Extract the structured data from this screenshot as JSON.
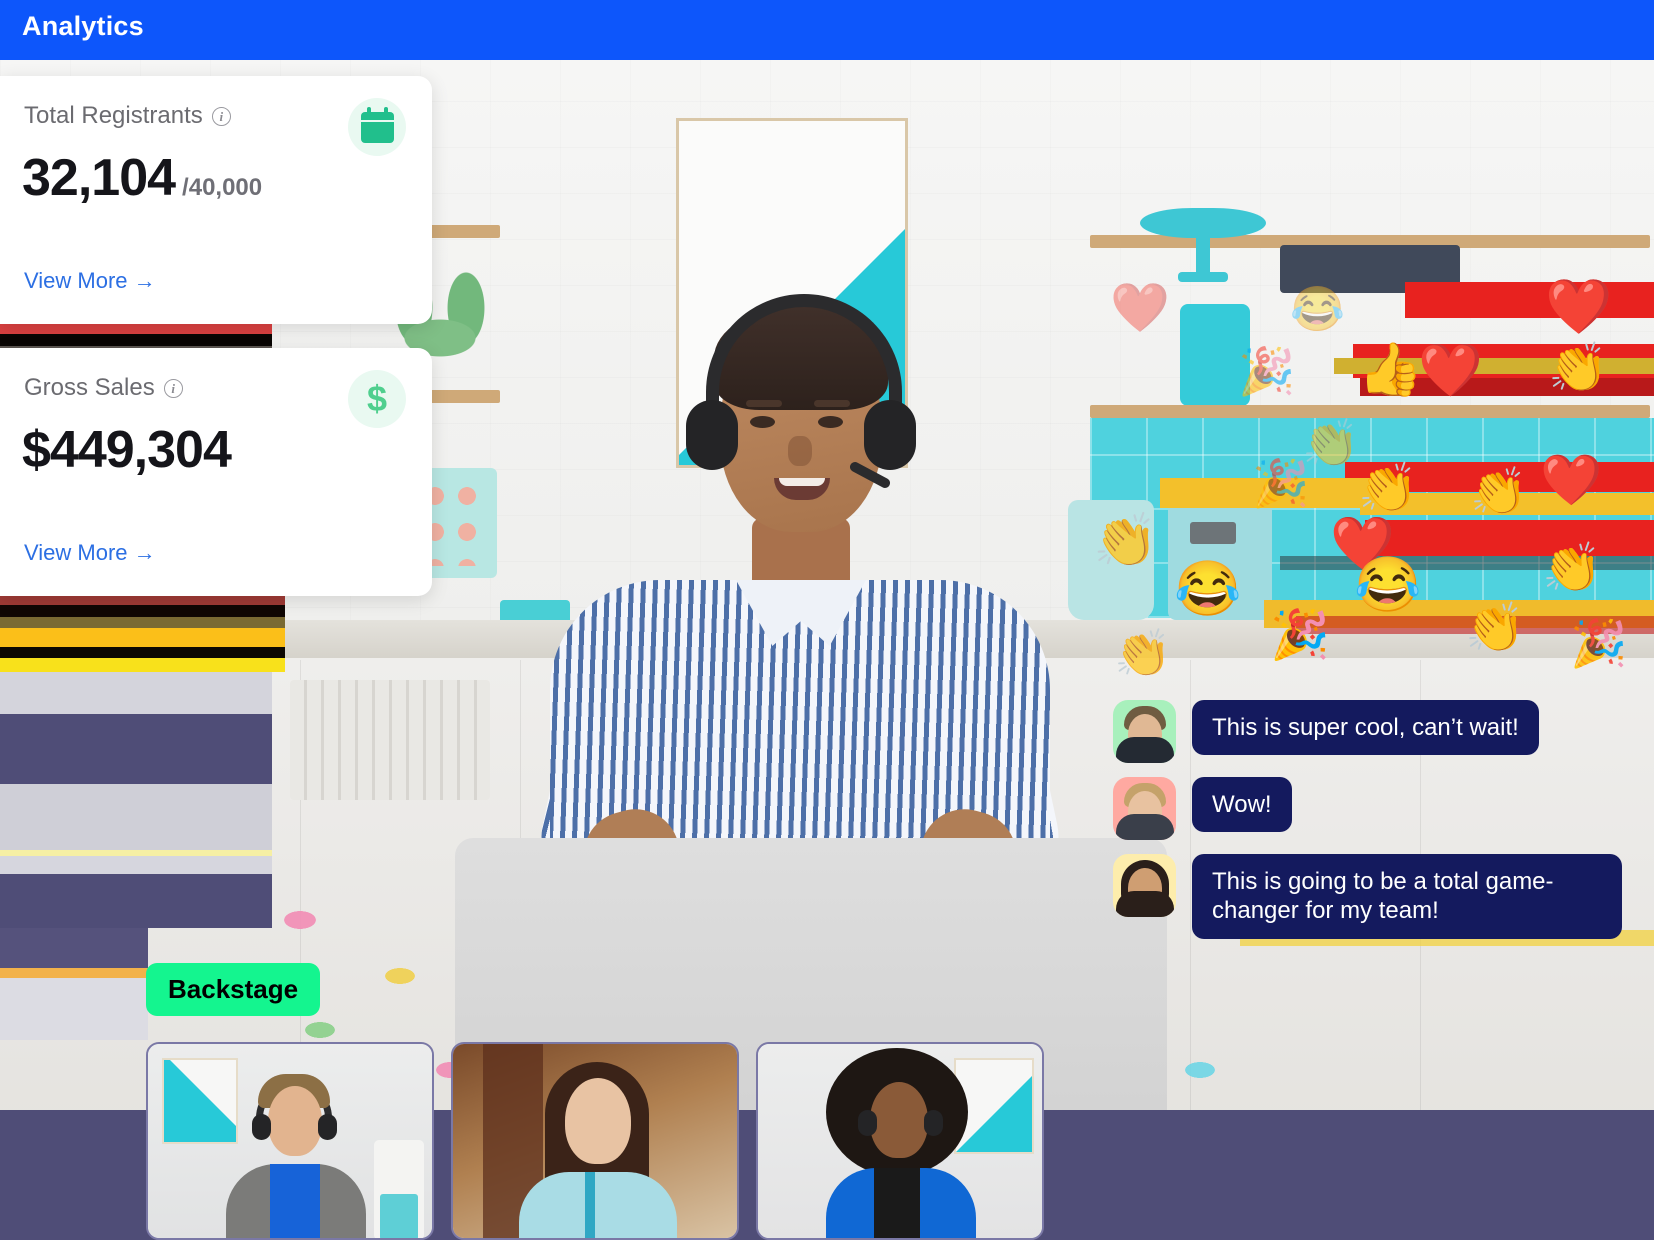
{
  "header": {
    "title": "Analytics",
    "bg_color": "#0d56fb"
  },
  "cards": [
    {
      "label": "Total Registrants",
      "info_icon": "info-circle-icon",
      "value": "32,104",
      "value_suffix": "/40,000",
      "icon": "calendar-icon",
      "icon_color": "#21bf8c",
      "link": "View More",
      "link_arrow": "→"
    },
    {
      "label": "Gross Sales",
      "info_icon": "info-circle-icon",
      "value": "$449,304",
      "value_suffix": "",
      "icon": "dollar-sign-icon",
      "icon_color": "#4fcf8e",
      "link": "View More",
      "link_arrow": "→"
    }
  ],
  "chat": {
    "messages": [
      {
        "avatar": "attendee-avatar-1",
        "text": "This is super cool, can’t wait!"
      },
      {
        "avatar": "attendee-avatar-2",
        "text": "Wow!"
      },
      {
        "avatar": "attendee-avatar-3",
        "text": "This is going to be a total game-changer for my team!"
      }
    ],
    "bubble_color": "#141a5e"
  },
  "backstage": {
    "label": "Backstage",
    "color": "#14f58f"
  },
  "reactions": {
    "emojis": [
      "❤️",
      "😂",
      "👏",
      "👍",
      "🎉"
    ],
    "names": [
      "heart-emoji",
      "joy-emoji",
      "clap-emoji",
      "thumbs-up-emoji",
      "party-popper-emoji"
    ]
  },
  "stage": {
    "main_speaker": "main-presenter-video",
    "thumbnails": [
      {
        "name": "speaker-thumbnail-1"
      },
      {
        "name": "speaker-thumbnail-2"
      },
      {
        "name": "speaker-thumbnail-3"
      }
    ],
    "bottom_bar_color": "#4f4d77"
  }
}
